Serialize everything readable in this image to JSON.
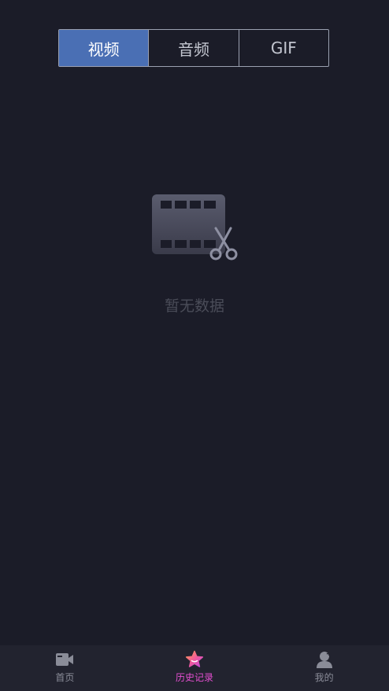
{
  "tabs": [
    {
      "label": "视频",
      "active": true
    },
    {
      "label": "音频",
      "active": false
    },
    {
      "label": "GIF",
      "active": false
    }
  ],
  "empty_state": {
    "icon": "film-scissors-icon",
    "text": "暂无数据"
  },
  "bottom_nav": {
    "items": [
      {
        "label": "首页",
        "icon": "video-camera-icon",
        "active": false
      },
      {
        "label": "历史记录",
        "icon": "star-icon",
        "active": true
      },
      {
        "label": "我的",
        "icon": "user-icon",
        "active": false
      }
    ]
  },
  "colors": {
    "background": "#1b1c28",
    "tab_active": "#4a6fb4",
    "nav_active": "#e64fd2",
    "nav_background": "#22232f"
  }
}
